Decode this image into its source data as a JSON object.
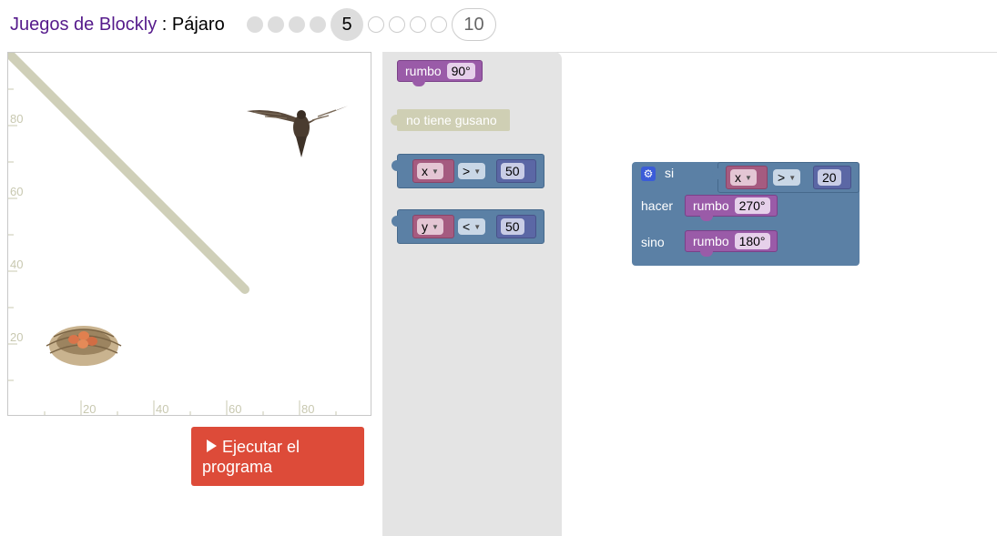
{
  "header": {
    "app_title": "Juegos de Blockly",
    "separator": " : ",
    "game_name": "Pájaro",
    "current_level": "5",
    "last_level": "10",
    "done_levels": 4,
    "todo_levels": 4
  },
  "visualization": {
    "axis_ticks": [
      "20",
      "40",
      "60",
      "80"
    ],
    "grid_color": "#c8c8b0"
  },
  "run_button": {
    "label": "Ejecutar el programa"
  },
  "toolbox": {
    "heading_block": {
      "label": "rumbo",
      "value": "90°"
    },
    "worm_block": {
      "label": "no tiene gusano"
    },
    "compare_block_1": {
      "variable": "x",
      "operator": ">",
      "value": "50"
    },
    "compare_block_2": {
      "variable": "y",
      "operator": "<",
      "value": "50"
    }
  },
  "workspace": {
    "if_block": {
      "if_label": "si",
      "do_label": "hacer",
      "else_label": "sino",
      "condition": {
        "variable": "x",
        "operator": ">",
        "value": "20"
      },
      "do_heading": {
        "label": "rumbo",
        "value": "270°"
      },
      "else_heading": {
        "label": "rumbo",
        "value": "180°"
      }
    }
  },
  "colors": {
    "accent_run": "#dd4b39",
    "heading_purple": "#9a5ba8",
    "logic_blue": "#5b80a5",
    "variable_pink": "#a55b80",
    "number_blue": "#5b67a5",
    "worm_khaki": "#cfcfb4",
    "link_purple": "#551a8b"
  }
}
